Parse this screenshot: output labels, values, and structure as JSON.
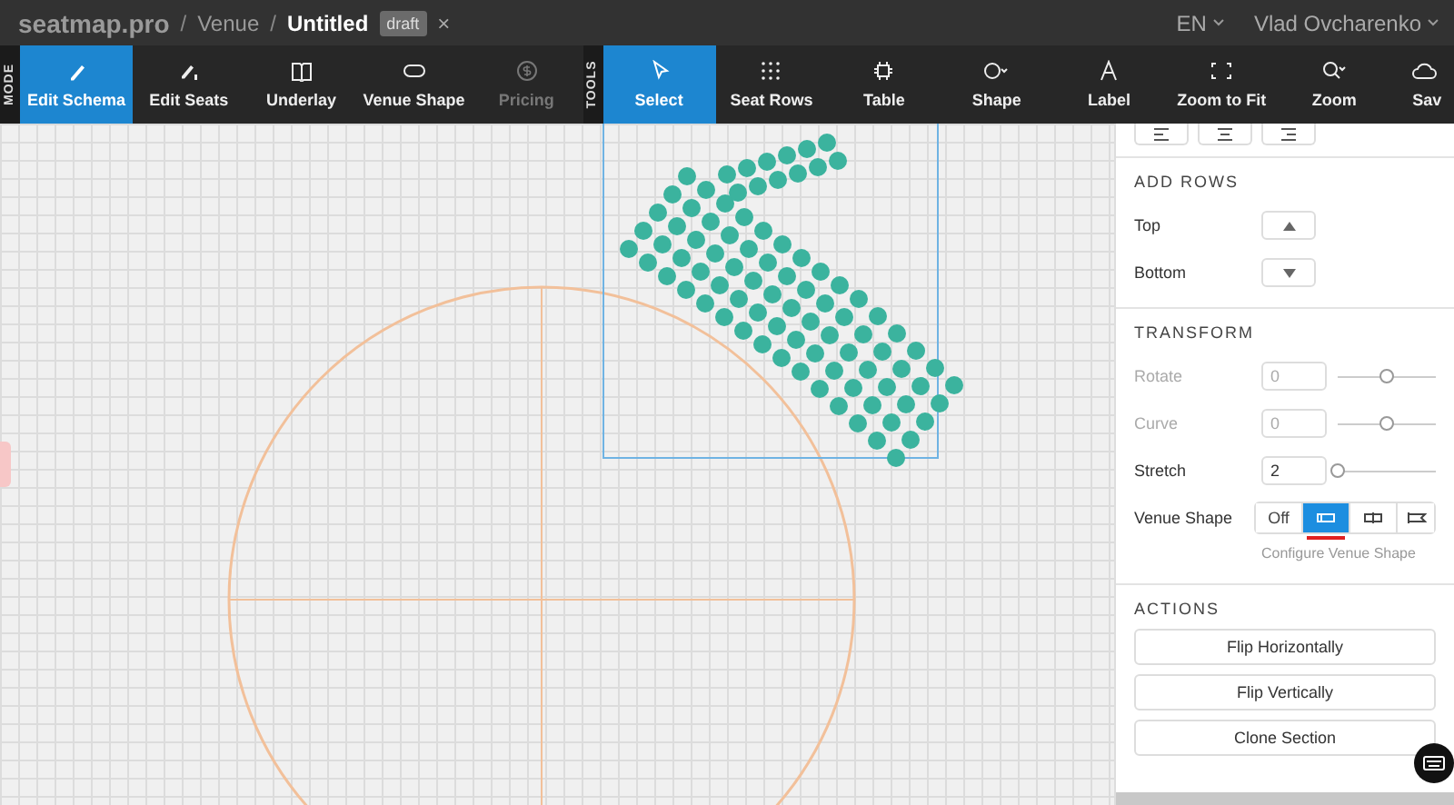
{
  "topbar": {
    "logo": "seatmap.pro",
    "breadcrumb": [
      {
        "separator": "/",
        "label": "Venue",
        "current": false
      },
      {
        "separator": "/",
        "label": "Untitled",
        "current": true
      }
    ],
    "badge": "draft",
    "close": "×",
    "language": "EN",
    "user": "Vlad Ovcharenko"
  },
  "mode_label": "MODE",
  "modes": [
    {
      "label": "Edit Schema",
      "selected": true,
      "disabled": false
    },
    {
      "label": "Edit Seats",
      "selected": false,
      "disabled": false
    },
    {
      "label": "Underlay",
      "selected": false,
      "disabled": false
    },
    {
      "label": "Venue Shape",
      "selected": false,
      "disabled": false
    },
    {
      "label": "Pricing",
      "selected": false,
      "disabled": true
    }
  ],
  "tools_label": "TOOLS",
  "tools": [
    {
      "label": "Select",
      "selected": true
    },
    {
      "label": "Seat Rows",
      "selected": false
    },
    {
      "label": "Table",
      "selected": false
    },
    {
      "label": "Shape",
      "selected": false
    },
    {
      "label": "Label",
      "selected": false
    },
    {
      "label": "Zoom to Fit",
      "selected": false
    },
    {
      "label": "Zoom",
      "selected": false
    },
    {
      "label": "Sav",
      "selected": false
    }
  ],
  "panel": {
    "add_rows": {
      "title": "ADD ROWS",
      "rows": [
        {
          "label": "Top"
        },
        {
          "label": "Bottom"
        }
      ]
    },
    "transform": {
      "title": "TRANSFORM",
      "rows": [
        {
          "label": "Rotate",
          "value": "0",
          "level": 0.5,
          "disabled": true
        },
        {
          "label": "Curve",
          "value": "0",
          "level": 0.5,
          "disabled": true
        },
        {
          "label": "Stretch",
          "value": "2",
          "level": 0.0,
          "disabled": false
        }
      ],
      "venue_shape": {
        "label": "Venue Shape",
        "options": [
          {
            "kind": "text",
            "label": "Off",
            "selected": false
          },
          {
            "kind": "icon",
            "selected": true
          },
          {
            "kind": "icon",
            "selected": false
          },
          {
            "kind": "icon",
            "selected": false
          }
        ],
        "hint": "Configure Venue Shape"
      }
    },
    "actions": {
      "title": "ACTIONS",
      "buttons": [
        "Flip Horizontally",
        "Flip Vertically",
        "Clone Section"
      ]
    }
  }
}
